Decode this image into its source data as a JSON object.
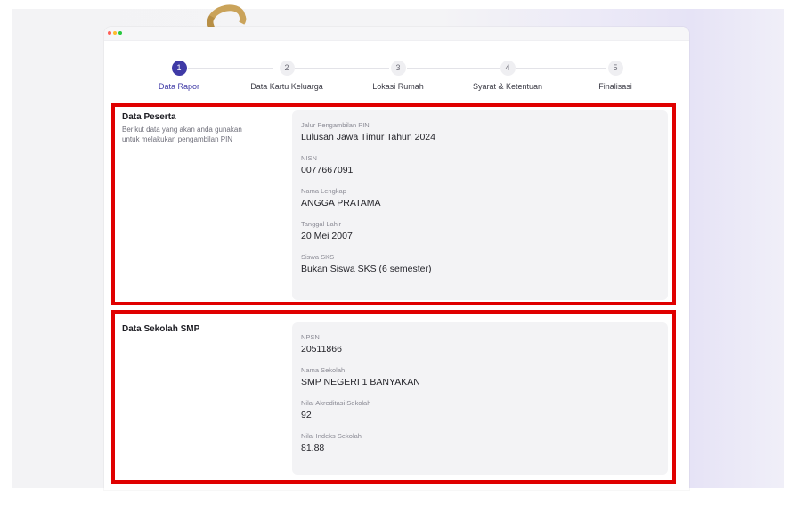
{
  "stepper": {
    "steps": [
      {
        "number": "1",
        "label": "Data Rapor"
      },
      {
        "number": "2",
        "label": "Data Kartu Keluarga"
      },
      {
        "number": "3",
        "label": "Lokasi Rumah"
      },
      {
        "number": "4",
        "label": "Syarat & Ketentuan"
      },
      {
        "number": "5",
        "label": "Finalisasi"
      }
    ],
    "active_step": "1",
    "active_color": "#3f3aa6"
  },
  "peserta": {
    "title": "Data Peserta",
    "description": "Berikut data yang akan anda gunakan untuk melakukan pengambilan PIN",
    "fields": [
      {
        "label": "Jalur Pengambilan PIN",
        "value": "Lulusan Jawa Timur Tahun 2024"
      },
      {
        "label": "NISN",
        "value": "0077667091"
      },
      {
        "label": "Nama Lengkap",
        "value": "ANGGA PRATAMA"
      },
      {
        "label": "Tanggal Lahir",
        "value": "20 Mei 2007"
      },
      {
        "label": "Siswa SKS",
        "value": "Bukan Siswa SKS (6 semester)"
      }
    ]
  },
  "sekolah": {
    "title": "Data Sekolah SMP",
    "fields": [
      {
        "label": "NPSN",
        "value": "20511866"
      },
      {
        "label": "Nama Sekolah",
        "value": "SMP NEGERI 1 BANYAKAN"
      },
      {
        "label": "Nilai Akreditasi Sekolah",
        "value": "92"
      },
      {
        "label": "Nilai Indeks Sekolah",
        "value": "81.88"
      }
    ]
  },
  "highlight_color": "#e00000"
}
